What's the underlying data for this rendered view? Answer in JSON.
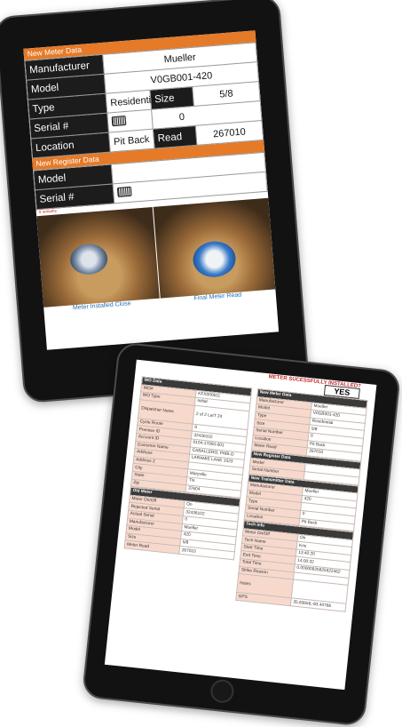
{
  "tablet1": {
    "new_meter_header": "New Meter Data",
    "manufacturer_label": "Manufacturer",
    "manufacturer_value": "Mueller",
    "model_label": "Model",
    "model_value": "V0GB001-420",
    "type_label": "Type",
    "type_value": "Residential",
    "size_label": "Size",
    "size_value": "5/8",
    "serial_label": "Serial #",
    "serial_value": "0",
    "location_label": "Location",
    "location_value": "Pit Back",
    "read_label": "Read",
    "read_value": "267010",
    "new_register_header": "New Register Data",
    "reg_model_label": "Model",
    "reg_model_value": "",
    "reg_serial_label": "Serial #",
    "reg_warning": "0 remarks",
    "caption_left": "Meter Installed Close",
    "caption_right": "Final Meter Read"
  },
  "tablet2": {
    "banner_text": "METER SUCESSFULLY INSTALLED?",
    "banner_answer": "YES",
    "left_sections": [
      {
        "header": "WO Data",
        "rows": [
          {
            "k": "WO#",
            "v": "KFX000611"
          },
          {
            "k": "WO Type",
            "v": "Initial"
          },
          {
            "k": "Dispatcher Notes",
            "v": "2 of 2   LetT 24"
          },
          {
            "k": "Cycle Route",
            "v": "9"
          },
          {
            "k": "Premise ID",
            "v": "32436102"
          },
          {
            "k": "Account ID",
            "v": "0104-17000-001"
          },
          {
            "k": "Customer Name",
            "v": "CABALLERO, PABLO"
          },
          {
            "k": "Address",
            "v": "LARAMIE LANE 1023"
          },
          {
            "k": "Address 2",
            "v": ""
          },
          {
            "k": "City",
            "v": "Maryville"
          },
          {
            "k": "State",
            "v": "TN"
          },
          {
            "k": "Zip",
            "v": "37604"
          }
        ]
      },
      {
        "header": "Old Meter",
        "rows": [
          {
            "k": "Meter On/Off",
            "v": "On"
          },
          {
            "k": "Rejected Serial",
            "v": "32436102"
          },
          {
            "k": "Actual Serial",
            "v": "0"
          },
          {
            "k": "Manufacturer",
            "v": "Mueller"
          },
          {
            "k": "Model",
            "v": "420"
          },
          {
            "k": "Size",
            "v": "5/8"
          },
          {
            "k": "Meter Read",
            "v": "267010"
          }
        ]
      }
    ],
    "right_sections": [
      {
        "header": "New Meter Data",
        "rows": [
          {
            "k": "Manufacturer",
            "v": "Mueller"
          },
          {
            "k": "Model",
            "v": "V0GB001-420"
          },
          {
            "k": "Type",
            "v": "Residential"
          },
          {
            "k": "Size",
            "v": "5/8"
          },
          {
            "k": "Serial Number",
            "v": "0"
          },
          {
            "k": "Location",
            "v": "Pit Back"
          },
          {
            "k": "Meter Read",
            "v": "267010"
          }
        ]
      },
      {
        "header": "New Register Data",
        "rows": [
          {
            "k": "Model",
            "v": ""
          },
          {
            "k": "Serial Number",
            "v": ""
          }
        ]
      },
      {
        "header": "New Transmitter Data",
        "rows": [
          {
            "k": "Manufacturer",
            "v": "Mueller"
          },
          {
            "k": "Model",
            "v": "420"
          },
          {
            "k": "Type",
            "v": ""
          },
          {
            "k": "Serial Number",
            "v": "0"
          },
          {
            "k": "Location",
            "v": "Pit Back"
          }
        ]
      },
      {
        "header": "Tech Info",
        "rows": [
          {
            "k": "Meter On/Off",
            "v": "On"
          },
          {
            "k": "Tech Name",
            "v": "Kris"
          },
          {
            "k": "Start Time",
            "v": "13:40:20"
          },
          {
            "k": "End Time",
            "v": "14:00:32"
          },
          {
            "k": "Total Time",
            "v": "0.00000925925922462"
          },
          {
            "k": "Strike Reason",
            "v": ""
          },
          {
            "k": "Notes",
            "v": ""
          },
          {
            "k": "GPS",
            "v": "35.83656,-83.40766"
          }
        ]
      }
    ]
  }
}
